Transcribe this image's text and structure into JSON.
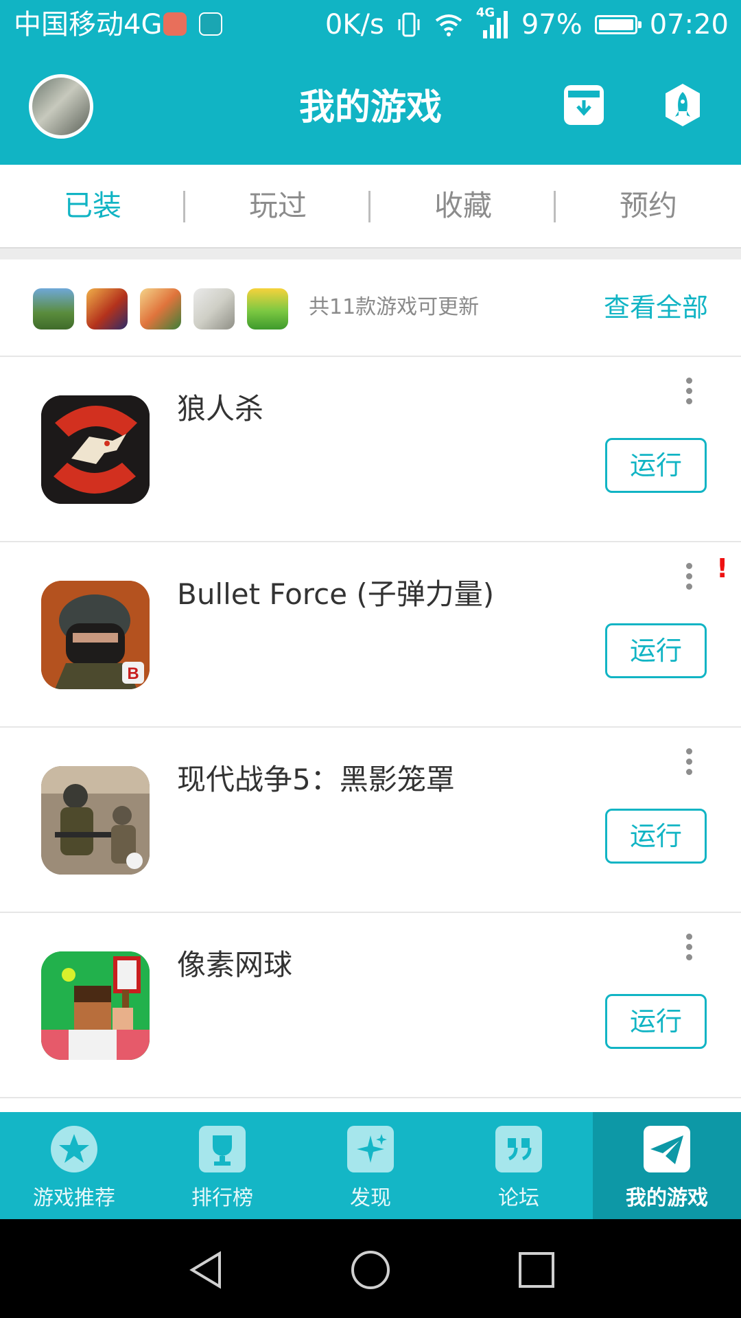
{
  "status_bar": {
    "carrier": "中国移动4G",
    "net_speed": "0K/s",
    "network_label": "4G",
    "battery": "97%",
    "time": "07:20"
  },
  "header": {
    "title": "我的游戏"
  },
  "tabs": [
    {
      "label": "已装",
      "active": true
    },
    {
      "label": "玩过",
      "active": false
    },
    {
      "label": "收藏",
      "active": false
    },
    {
      "label": "预约",
      "active": false
    }
  ],
  "updates": {
    "text": "共11款游戏可更新",
    "view_all": "查看全部"
  },
  "games": [
    {
      "name": "狼人杀",
      "action": "运行"
    },
    {
      "name": "Bullet Force (子弹力量)",
      "action": "运行",
      "alert": "!"
    },
    {
      "name": "现代战争5：黑影笼罩",
      "action": "运行"
    },
    {
      "name": "像素网球",
      "action": "运行"
    }
  ],
  "bottom_nav": [
    {
      "label": "游戏推荐",
      "icon": "star-icon"
    },
    {
      "label": "排行榜",
      "icon": "trophy-icon"
    },
    {
      "label": "发现",
      "icon": "sparkle-icon"
    },
    {
      "label": "论坛",
      "icon": "quote-icon"
    },
    {
      "label": "我的游戏",
      "icon": "paper-plane-icon",
      "active": true
    }
  ],
  "colors": {
    "accent": "#11b4c4",
    "nav_active": "#0d98a6",
    "alert": "#ee1111"
  }
}
